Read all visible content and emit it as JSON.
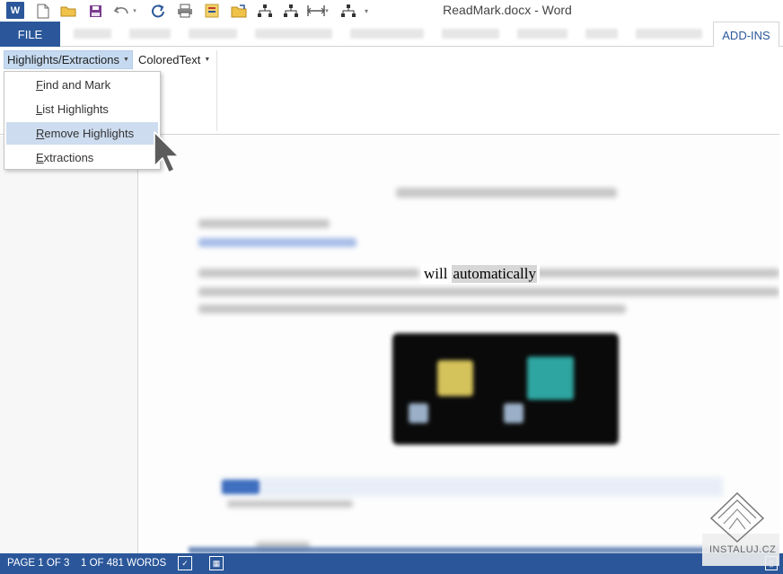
{
  "window": {
    "title": "ReadMark.docx - Word",
    "app_icon": "W"
  },
  "quick_access": {
    "icons": [
      "save-icon",
      "undo-icon",
      "redo-icon",
      "print-icon",
      "open-icon",
      "new-icon",
      "org-chart-icon",
      "ruler-icon",
      "customize-icon"
    ]
  },
  "ribbon": {
    "file_tab": "FILE",
    "active_tab": "ADD-INS",
    "highlights_dropdown": "Highlights/Extractions",
    "coloredtext_dropdown": "ColoredText"
  },
  "menu": {
    "items": [
      {
        "prefix": "F",
        "rest": "ind and Mark"
      },
      {
        "prefix": "L",
        "rest": "ist Highlights"
      },
      {
        "prefix": "R",
        "rest": "emove Highlights"
      },
      {
        "prefix": "E",
        "rest": "xtractions"
      }
    ],
    "hovered_index": 2
  },
  "document": {
    "visible_word_1": "will",
    "visible_word_2": "automatically"
  },
  "statusbar": {
    "page": "PAGE 1 OF 3",
    "words": "1 OF 481 WORDS"
  },
  "watermark": {
    "text": "INSTALUJ.CZ"
  },
  "colors": {
    "accent": "#2b579a",
    "menu_hover": "#cddcef",
    "selection": "#d7d7d7"
  }
}
